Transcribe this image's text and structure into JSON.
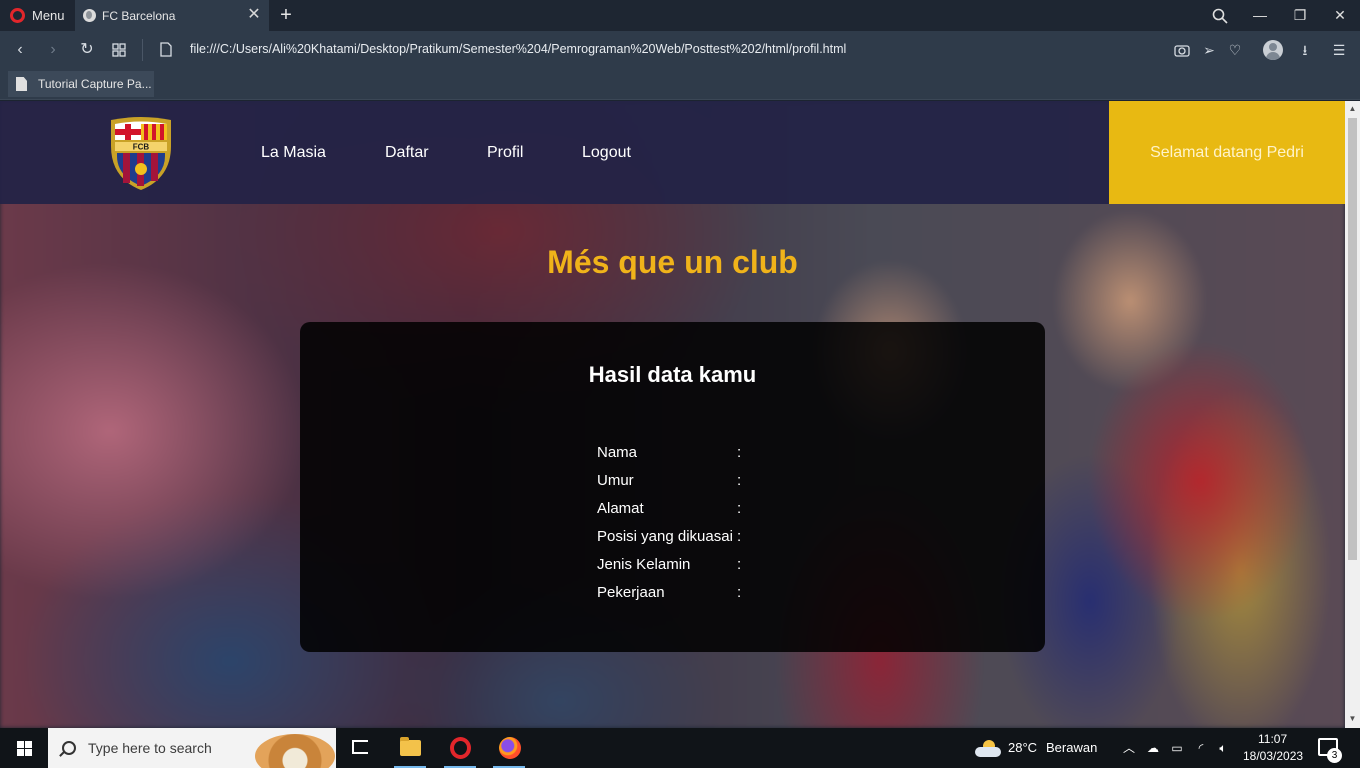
{
  "browser": {
    "menu_label": "Menu",
    "tab_title": "FC Barcelona",
    "url": "file:///C:/Users/Ali%20Khatami/Desktop/Pratikum/Semester%204/Pemrograman%20Web/Posttest%202/html/profil.html",
    "bookmark": "Tutorial Capture Pa..."
  },
  "site": {
    "nav": [
      "La Masia",
      "Daftar",
      "Profil",
      "Logout"
    ],
    "welcome": "Selamat datang Pedri",
    "headline": "Més que un club",
    "card_title": "Hasil data kamu",
    "colon": ":",
    "fields": [
      {
        "label": "Nama",
        "value": ""
      },
      {
        "label": "Umur",
        "value": ""
      },
      {
        "label": "Alamat",
        "value": ""
      },
      {
        "label": "Posisi yang dikuasai",
        "value": ""
      },
      {
        "label": "Jenis Kelamin",
        "value": ""
      },
      {
        "label": "Pekerjaan",
        "value": ""
      }
    ],
    "crest_text": "FCB",
    "colors": {
      "accent_yellow": "#e8b912",
      "headline_gold": "#f0b31a",
      "header_navy": "#222246"
    }
  },
  "taskbar": {
    "search_placeholder": "Type here to search",
    "weather_temp": "28°C",
    "weather_desc": "Berawan",
    "time": "11:07",
    "date": "18/03/2023",
    "notification_count": "3"
  }
}
